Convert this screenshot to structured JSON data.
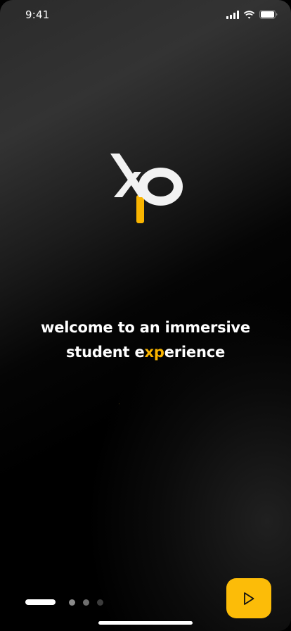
{
  "status_bar": {
    "time": "9:41",
    "icons": [
      "cellular-signal-icon",
      "wifi-icon",
      "battery-icon"
    ]
  },
  "logo": {
    "text": "XP",
    "colors": {
      "primary": "#ffffff",
      "accent": "#f9b400"
    }
  },
  "headline": {
    "line1": "welcome to an immersive",
    "line2_prefix": "student e",
    "line2_accent": "xp",
    "line2_suffix": "erience"
  },
  "pagination": {
    "total_pages": 4,
    "current_page": 1
  },
  "next_button": {
    "icon": "play-arrow-icon",
    "color": "#fcbc08"
  },
  "colors": {
    "accent": "#f9b400",
    "text": "#ffffff",
    "background": "#000000"
  }
}
